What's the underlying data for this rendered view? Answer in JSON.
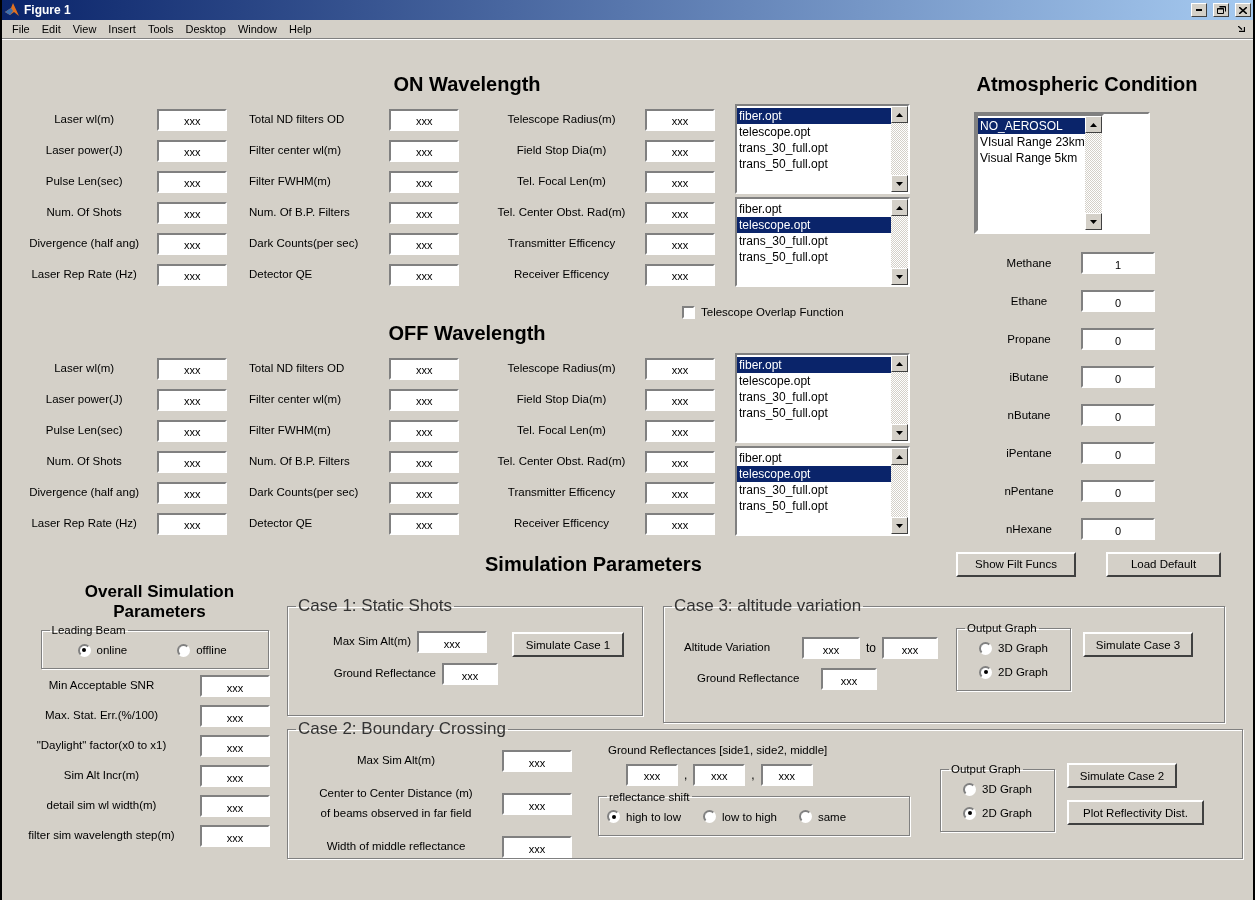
{
  "window": {
    "title": "Figure 1"
  },
  "menu": [
    "File",
    "Edit",
    "View",
    "Insert",
    "Tools",
    "Desktop",
    "Window",
    "Help"
  ],
  "sections": [
    {
      "heading": "ON Wavelength",
      "columns": [
        [
          {
            "label": "Laser wl(m)",
            "value": "xxx"
          },
          {
            "label": "Laser power(J)",
            "value": "xxx"
          },
          {
            "label": "Pulse Len(sec)",
            "value": "xxx"
          },
          {
            "label": "Num. Of Shots",
            "value": "xxx"
          },
          {
            "label": "Divergence (half ang)",
            "value": "xxx"
          },
          {
            "label": "Laser Rep Rate (Hz)",
            "value": "xxx"
          }
        ],
        [
          {
            "label": "Total ND filters OD",
            "value": "xxx"
          },
          {
            "label": "Filter center wl(m)",
            "value": "xxx"
          },
          {
            "label": "Filter FWHM(m)",
            "value": "xxx"
          },
          {
            "label": "Num. Of B.P. Filters",
            "value": "xxx"
          },
          {
            "label": "Dark Counts(per sec)",
            "value": "xxx"
          },
          {
            "label": "Detector QE",
            "value": "xxx"
          }
        ],
        [
          {
            "label": "Telescope Radius(m)",
            "value": "xxx"
          },
          {
            "label": "Field Stop Dia(m)",
            "value": "xxx"
          },
          {
            "label": "Tel. Focal Len(m)",
            "value": "xxx"
          },
          {
            "label": "Tel. Center Obst. Rad(m)",
            "value": "xxx"
          },
          {
            "label": "Transmitter Efficency",
            "value": "xxx"
          },
          {
            "label": "Receiver Efficency",
            "value": "xxx"
          }
        ]
      ],
      "listboxes": [
        {
          "items": [
            {
              "label": "fiber.opt",
              "selected": true
            },
            {
              "label": "telescope.opt",
              "selected": false
            },
            {
              "label": "trans_30_full.opt",
              "selected": false
            },
            {
              "label": "trans_50_full.opt",
              "selected": false
            }
          ]
        },
        {
          "items": [
            {
              "label": "fiber.opt",
              "selected": false
            },
            {
              "label": "telescope.opt",
              "selected": true
            },
            {
              "label": "trans_30_full.opt",
              "selected": false
            },
            {
              "label": "trans_50_full.opt",
              "selected": false
            }
          ]
        }
      ]
    },
    {
      "heading": "OFF Wavelength",
      "columns": [
        [
          {
            "label": "Laser wl(m)",
            "value": "xxx"
          },
          {
            "label": "Laser power(J)",
            "value": "xxx"
          },
          {
            "label": "Pulse Len(sec)",
            "value": "xxx"
          },
          {
            "label": "Num. Of Shots",
            "value": "xxx"
          },
          {
            "label": "Divergence (half ang)",
            "value": "xxx"
          },
          {
            "label": "Laser Rep Rate (Hz)",
            "value": "xxx"
          }
        ],
        [
          {
            "label": "Total ND filters OD",
            "value": "xxx"
          },
          {
            "label": "Filter center wl(m)",
            "value": "xxx"
          },
          {
            "label": "Filter FWHM(m)",
            "value": "xxx"
          },
          {
            "label": "Num. Of B.P. Filters",
            "value": "xxx"
          },
          {
            "label": "Dark Counts(per sec)",
            "value": "xxx"
          },
          {
            "label": "Detector QE",
            "value": "xxx"
          }
        ],
        [
          {
            "label": "Telescope Radius(m)",
            "value": "xxx"
          },
          {
            "label": "Field Stop Dia(m)",
            "value": "xxx"
          },
          {
            "label": "Tel. Focal Len(m)",
            "value": "xxx"
          },
          {
            "label": "Tel. Center Obst. Rad(m)",
            "value": "xxx"
          },
          {
            "label": "Transmitter Efficency",
            "value": "xxx"
          },
          {
            "label": "Receiver Efficency",
            "value": "xxx"
          }
        ]
      ],
      "listboxes": [
        {
          "items": [
            {
              "label": "fiber.opt",
              "selected": true
            },
            {
              "label": "telescope.opt",
              "selected": false
            },
            {
              "label": "trans_30_full.opt",
              "selected": false
            },
            {
              "label": "trans_50_full.opt",
              "selected": false
            }
          ]
        },
        {
          "items": [
            {
              "label": "fiber.opt",
              "selected": false
            },
            {
              "label": "telescope.opt",
              "selected": true
            },
            {
              "label": "trans_30_full.opt",
              "selected": false
            },
            {
              "label": "trans_50_full.opt",
              "selected": false
            }
          ]
        }
      ]
    }
  ],
  "overlap_checkbox": {
    "label": "Telescope Overlap Function",
    "checked": false
  },
  "atmosphere": {
    "heading": "Atmospheric Condition",
    "listbox": {
      "items": [
        {
          "label": "NO_AEROSOL",
          "selected": true
        },
        {
          "label": "VIsual Range 23km",
          "selected": false
        },
        {
          "label": "Visual Range 5km",
          "selected": false
        }
      ]
    },
    "gases": [
      {
        "label": "Methane",
        "value": "1"
      },
      {
        "label": "Ethane",
        "value": "0"
      },
      {
        "label": "Propane",
        "value": "0"
      },
      {
        "label": "iButane",
        "value": "0"
      },
      {
        "label": "nButane",
        "value": "0"
      },
      {
        "label": "iPentane",
        "value": "0"
      },
      {
        "label": "nPentane",
        "value": "0"
      },
      {
        "label": "nHexane",
        "value": "0"
      }
    ]
  },
  "simulation": {
    "heading": "Simulation Parameters",
    "buttons": [
      "Show Filt Funcs",
      "Load Default"
    ],
    "overall": {
      "heading": "Overall Simulation Parameters",
      "leading_beam": {
        "title": "Leading Beam",
        "options": [
          {
            "label": "online",
            "selected": true
          },
          {
            "label": "offline",
            "selected": false
          }
        ]
      },
      "fields": [
        {
          "label": "Min Acceptable SNR",
          "value": "xxx"
        },
        {
          "label": "Max. Stat. Err.(%/100)",
          "value": "xxx"
        },
        {
          "label": "\"Daylight\" factor(x0 to x1)",
          "value": "xxx"
        },
        {
          "label": "Sim Alt Incr(m)",
          "value": "xxx"
        },
        {
          "label": "detail sim wl width(m)",
          "value": "xxx"
        },
        {
          "label": "filter sim wavelength step(m)",
          "value": "xxx"
        }
      ]
    },
    "case1": {
      "title": "Case 1: Static Shots",
      "fields": [
        {
          "label": "Max Sim Alt(m)",
          "value": "xxx"
        },
        {
          "label": "Ground Reflectance",
          "value": "xxx"
        }
      ],
      "button": "Simulate Case 1"
    },
    "case3": {
      "title": "Case 3: altitude variation",
      "range": {
        "label": "Altitude Variation",
        "from": "xxx",
        "separator": "to",
        "to": "xxx"
      },
      "field": {
        "label": "Ground Reflectance",
        "value": "xxx"
      },
      "output_graph": {
        "title": "Output Graph",
        "options": [
          {
            "label": "3D Graph",
            "selected": false
          },
          {
            "label": "2D Graph",
            "selected": true
          }
        ]
      },
      "button": "Simulate Case 3"
    },
    "case2": {
      "title": "Case 2: Boundary Crossing",
      "fields": [
        {
          "label": "Max Sim Alt(m)",
          "value": "xxx"
        },
        {
          "label": "Center to Center Distance (m)\nof beams observed in far field",
          "value": "xxx"
        },
        {
          "label": "Width of middle reflectance",
          "value": "xxx"
        }
      ],
      "reflectances": {
        "label": "Ground Reflectances [side1, side2, middle]",
        "values": [
          "xxx",
          "xxx",
          "xxx"
        ],
        "separators": [
          ",",
          ","
        ]
      },
      "shift": {
        "title": "reflectance shift",
        "options": [
          {
            "label": "high to low",
            "selected": true
          },
          {
            "label": "low to high",
            "selected": false
          },
          {
            "label": "same",
            "selected": false
          }
        ]
      },
      "output_graph": {
        "title": "Output Graph",
        "options": [
          {
            "label": "3D Graph",
            "selected": false
          },
          {
            "label": "2D Graph",
            "selected": true
          }
        ]
      },
      "buttons": [
        "Simulate Case 2",
        "Plot Reflectivity Dist."
      ]
    }
  }
}
